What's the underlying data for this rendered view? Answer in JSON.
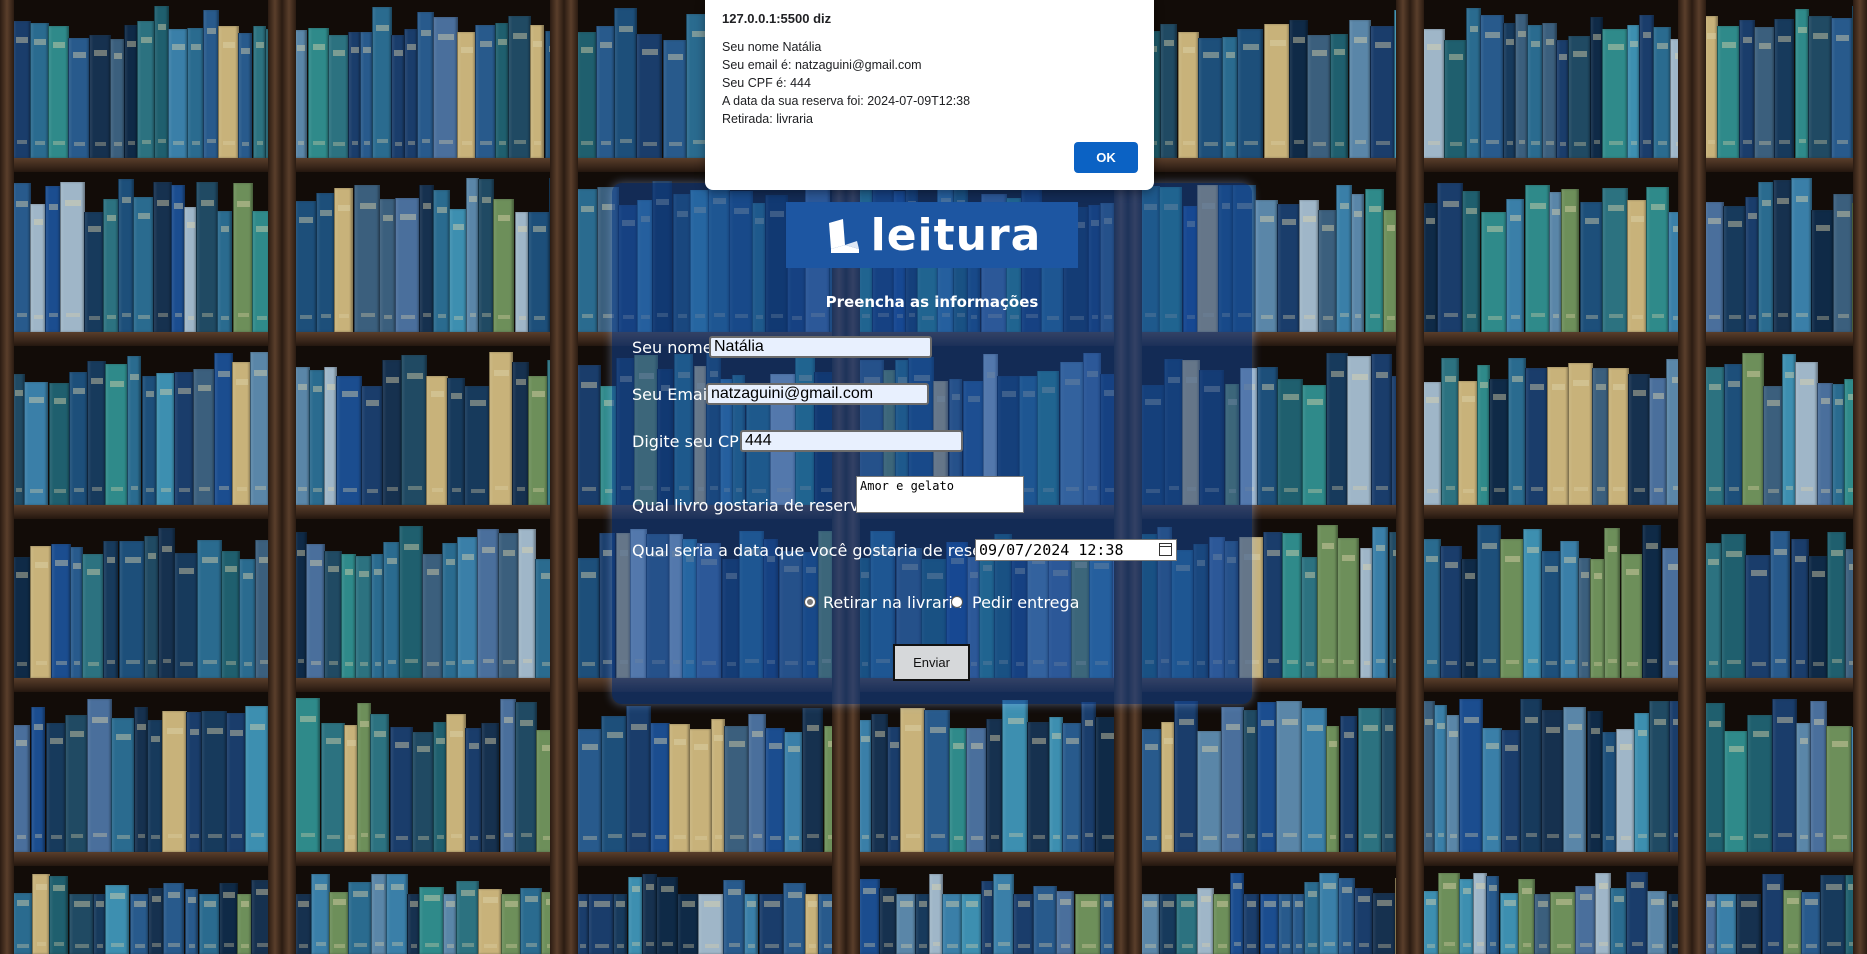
{
  "dialog": {
    "title": "127.0.0.1:5500 diz",
    "lines": [
      "Seu nome Natália",
      "Seu email é: natzaguini@gmail.com",
      "Seu CPF é: 444",
      "A data da sua reserva foi: 2024-07-09T12:38",
      "Retirada: livraria"
    ],
    "ok_label": "OK"
  },
  "brand": {
    "logo_text": "leitura",
    "logo_color": "#1d56a2"
  },
  "form": {
    "title": "Preencha as informações",
    "name_label": "Seu nome",
    "name_value": "Natália",
    "email_label": "Seu Email",
    "email_value": "natzaguini@gmail.com",
    "cpf_label": "Digite seu CPF",
    "cpf_value": "444",
    "book_label": "Qual livro gostaria de reservar?",
    "book_value": "Amor e gelato",
    "date_label": "Qual seria a data que você gostaria de reservar?",
    "date_value": "09/07/2024 12:38",
    "radio_pickup_label": "Retirar na livraria",
    "radio_pickup_checked": true,
    "radio_delivery_label": "Pedir entrega",
    "radio_delivery_checked": false,
    "submit_label": "Enviar"
  },
  "colors": {
    "accent": "#0b62c4",
    "card": "#14468e",
    "input_bg": "#e8f0fe"
  }
}
